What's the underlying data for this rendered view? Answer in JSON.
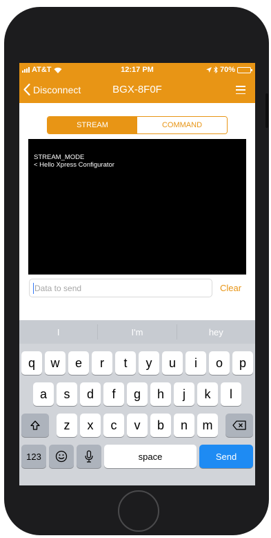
{
  "status_bar": {
    "carrier": "AT&T",
    "time": "12:17 PM",
    "battery": "70%",
    "battery_level": 0.7
  },
  "nav": {
    "back_label": "Disconnect",
    "title": "BGX-8F0F"
  },
  "mode_tabs": {
    "stream": "STREAM",
    "command": "COMMAND"
  },
  "terminal": {
    "lines": [
      "STREAM_MODE",
      "< Hello Xpress Configurator"
    ]
  },
  "input": {
    "placeholder": "Data to send",
    "clear_label": "Clear"
  },
  "keyboard": {
    "suggestions": [
      "I",
      "I'm",
      "hey"
    ],
    "row1": [
      "q",
      "w",
      "e",
      "r",
      "t",
      "y",
      "u",
      "i",
      "o",
      "p"
    ],
    "row2": [
      "a",
      "s",
      "d",
      "f",
      "g",
      "h",
      "j",
      "k",
      "l"
    ],
    "row3": [
      "z",
      "x",
      "c",
      "v",
      "b",
      "n",
      "m"
    ],
    "numbers_label": "123",
    "space_label": "space",
    "send_label": "Send"
  },
  "colors": {
    "accent": "#e89515",
    "send_key": "#1e8bf3",
    "terminal_bg": "#000000"
  }
}
